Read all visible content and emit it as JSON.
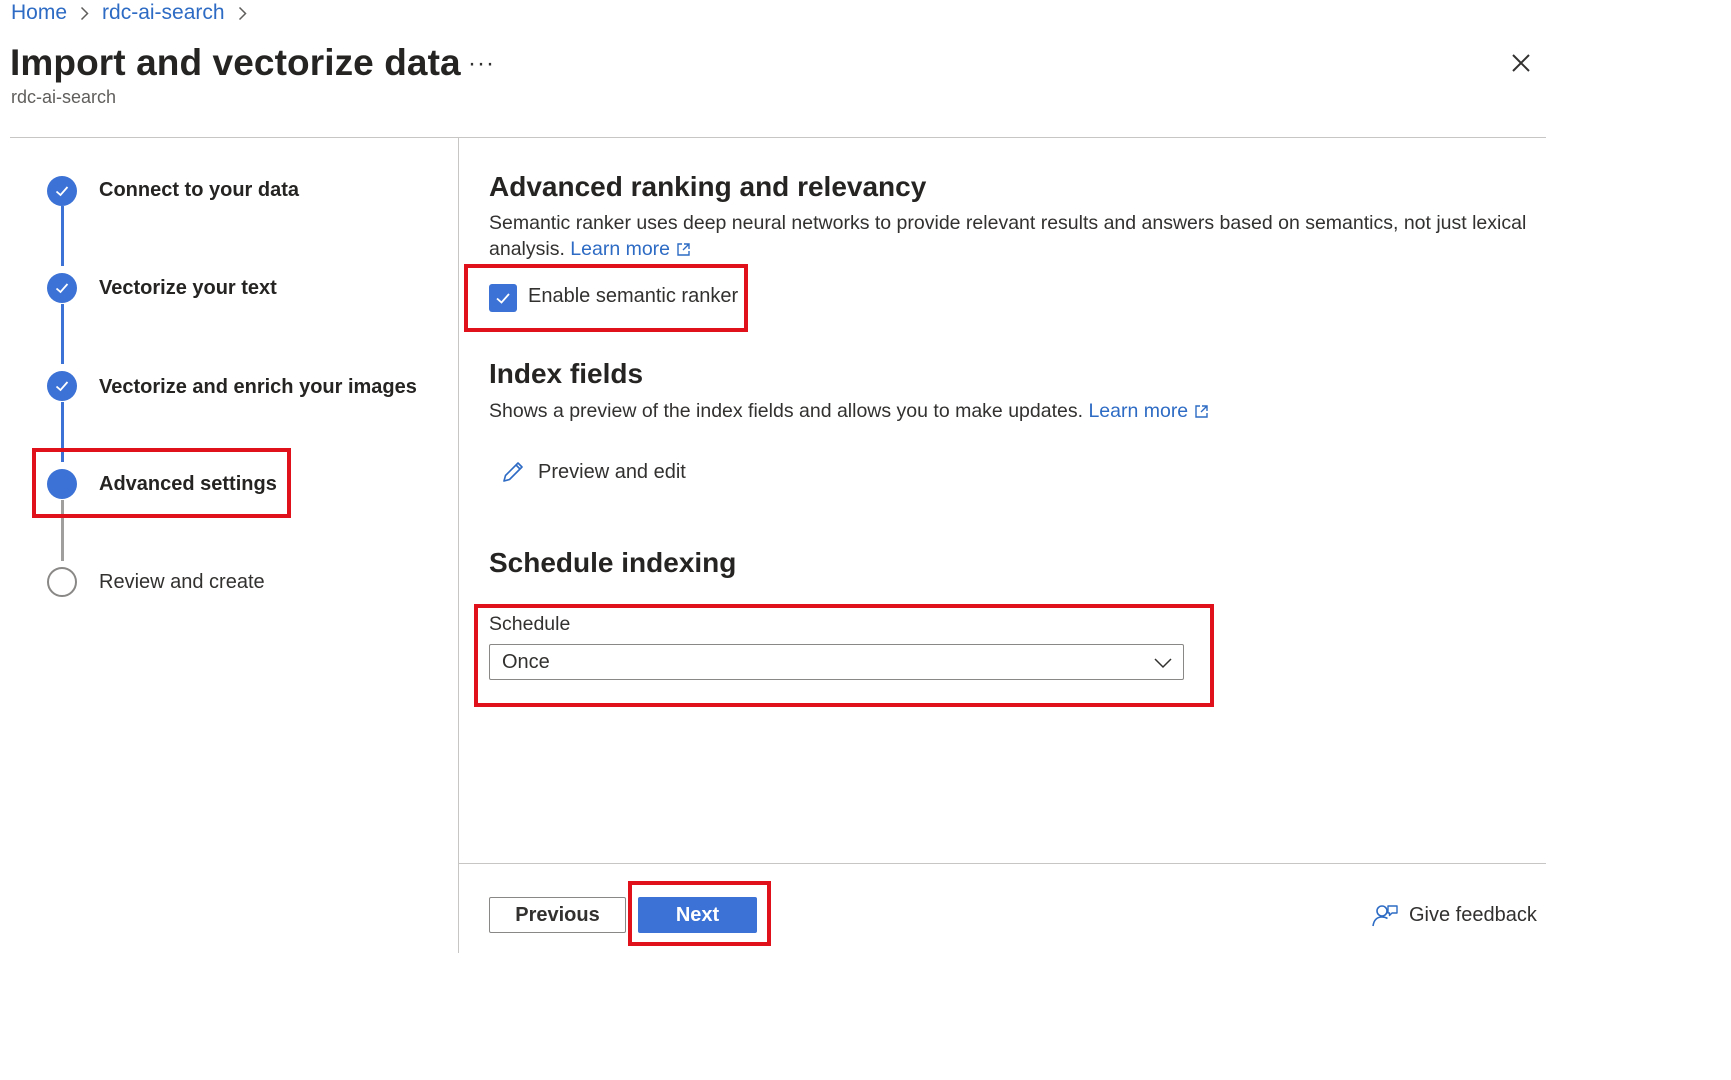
{
  "breadcrumb": {
    "items": [
      "Home",
      "rdc-ai-search"
    ]
  },
  "header": {
    "title": "Import and vectorize data",
    "more_label": "···",
    "subtitle": "rdc-ai-search"
  },
  "steps": [
    {
      "label": "Connect to your data",
      "state": "completed"
    },
    {
      "label": "Vectorize your text",
      "state": "completed"
    },
    {
      "label": "Vectorize and enrich your images",
      "state": "completed"
    },
    {
      "label": "Advanced settings",
      "state": "current"
    },
    {
      "label": "Review and create",
      "state": "pending"
    }
  ],
  "ranking": {
    "heading": "Advanced ranking and relevancy",
    "description": "Semantic ranker uses deep neural networks to provide relevant results and answers based on semantics, not just lexical analysis.",
    "learn_more": "Learn more",
    "checkbox_label": "Enable semantic ranker",
    "checkbox_checked": true
  },
  "index_fields": {
    "heading": "Index fields",
    "description": "Shows a preview of the index fields and allows you to make updates.",
    "learn_more": "Learn more",
    "edit_label": "Preview and edit"
  },
  "schedule": {
    "heading": "Schedule indexing",
    "field_label": "Schedule",
    "value": "Once"
  },
  "footer": {
    "previous": "Previous",
    "next": "Next",
    "feedback": "Give feedback"
  },
  "colors": {
    "accent": "#3c72d5",
    "link": "#2d6bc4",
    "highlight": "#e0111b"
  }
}
